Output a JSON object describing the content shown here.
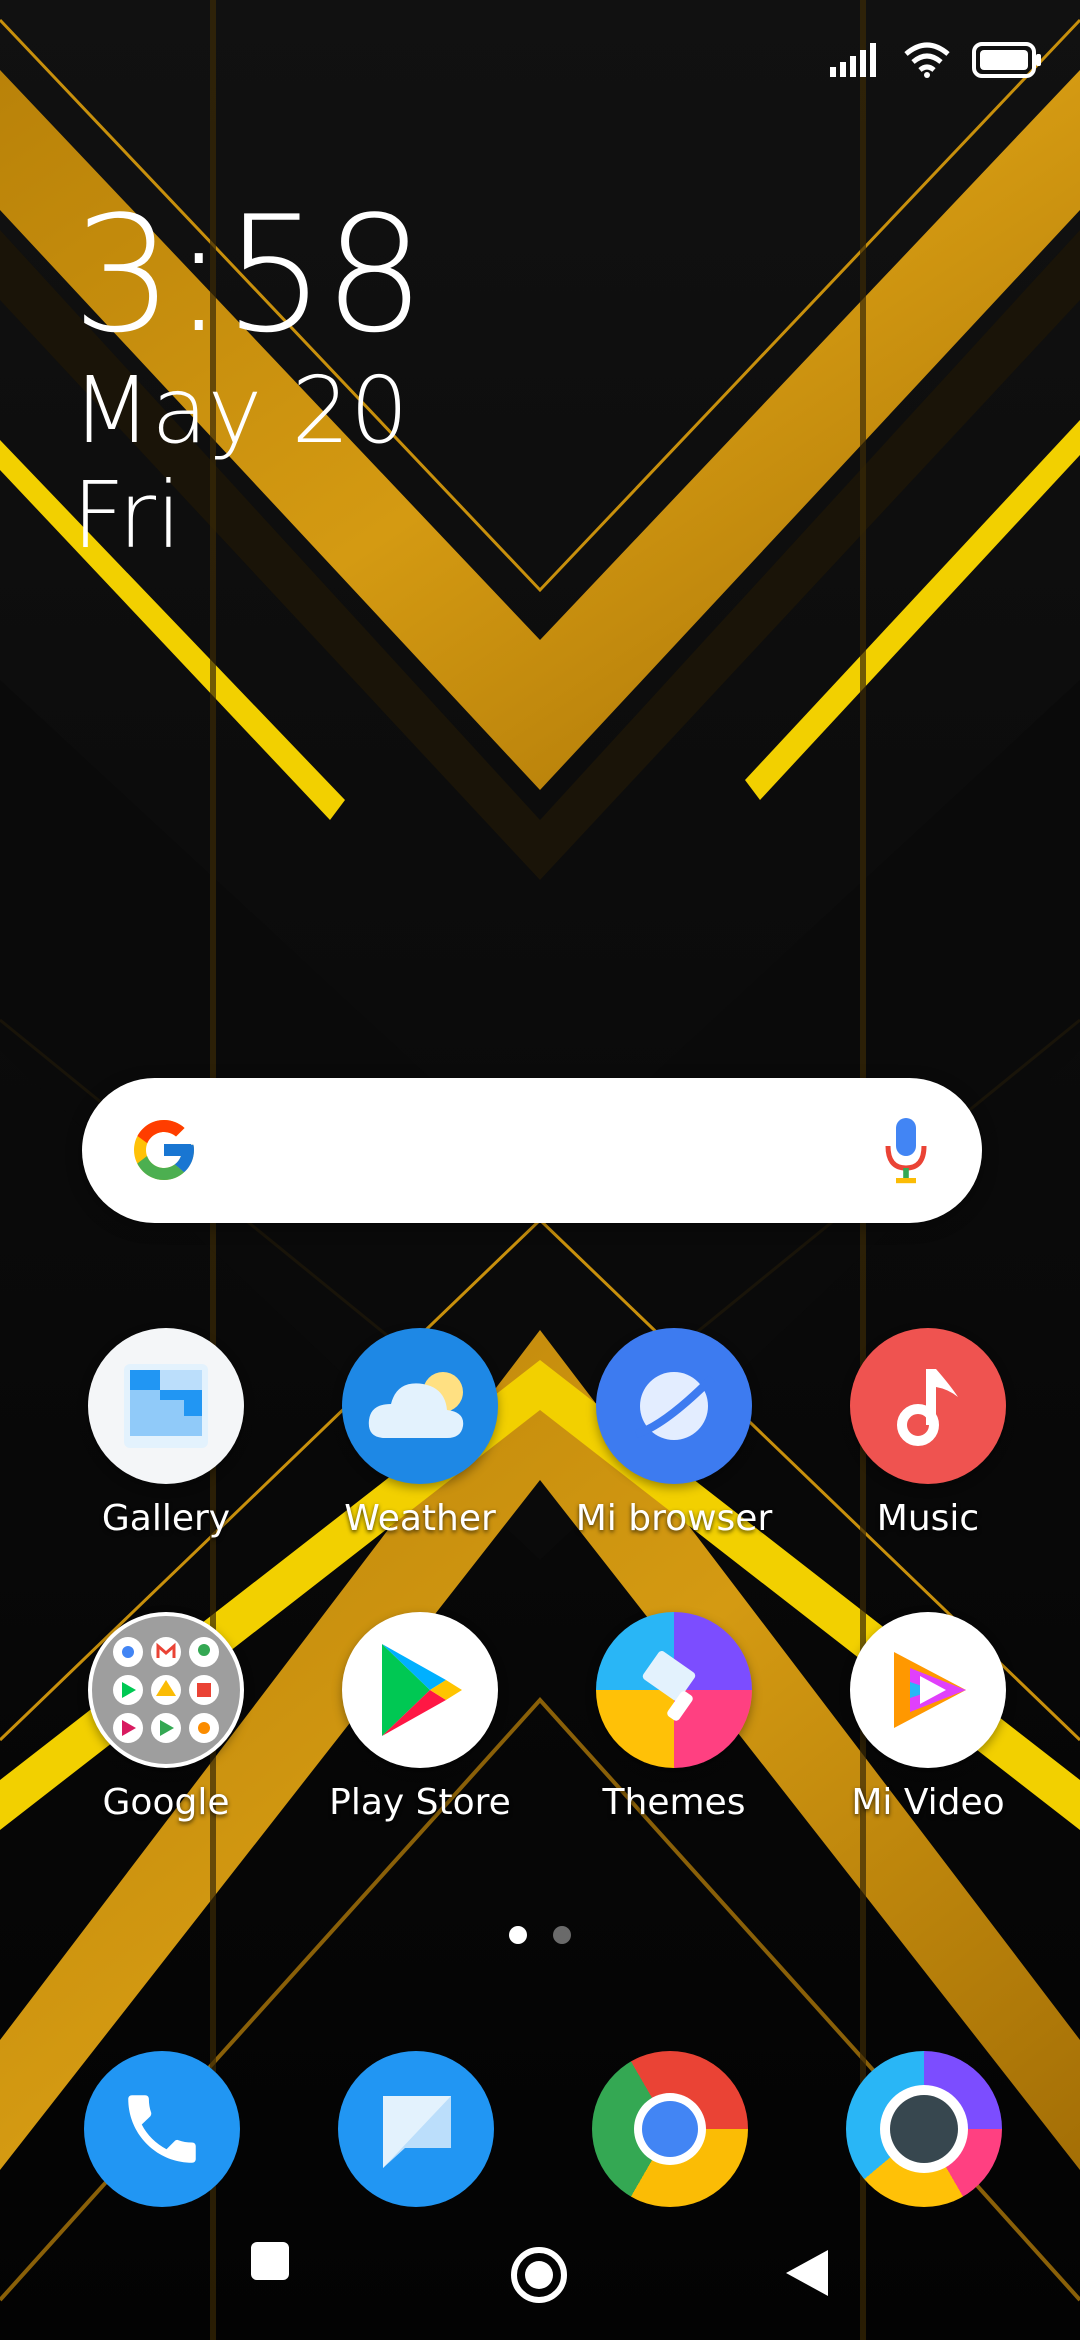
{
  "status_bar": {
    "signal_icon": "signal-bars-icon",
    "wifi_icon": "wifi-icon",
    "battery_icon": "battery-full-icon"
  },
  "clock": {
    "time": "3:58",
    "date": "May 20",
    "day": "Fri"
  },
  "search": {
    "logo_icon": "google-g-icon",
    "mic_icon": "microphone-icon"
  },
  "apps": [
    {
      "label": "Gallery",
      "icon": "gallery-icon"
    },
    {
      "label": "Weather",
      "icon": "weather-icon"
    },
    {
      "label": "Mi browser",
      "icon": "mi-browser-icon"
    },
    {
      "label": "Music",
      "icon": "music-icon"
    },
    {
      "label": "Google",
      "icon": "google-folder-icon"
    },
    {
      "label": "Play Store",
      "icon": "play-store-icon"
    },
    {
      "label": "Themes",
      "icon": "themes-icon"
    },
    {
      "label": "Mi Video",
      "icon": "mi-video-icon"
    }
  ],
  "page_indicator": {
    "pages": 2,
    "current": 1
  },
  "dock": [
    {
      "icon": "phone-icon"
    },
    {
      "icon": "messages-icon"
    },
    {
      "icon": "chrome-icon"
    },
    {
      "icon": "camera-icon"
    }
  ],
  "nav_bar": {
    "recents_icon": "recents-square-icon",
    "home_icon": "home-circle-icon",
    "back_icon": "back-triangle-icon"
  },
  "colors": {
    "wallpaper_gold": "#C8900C",
    "wallpaper_yellow": "#F2D000",
    "weather_blue": "#1E88E5",
    "music_red": "#EF5350"
  }
}
